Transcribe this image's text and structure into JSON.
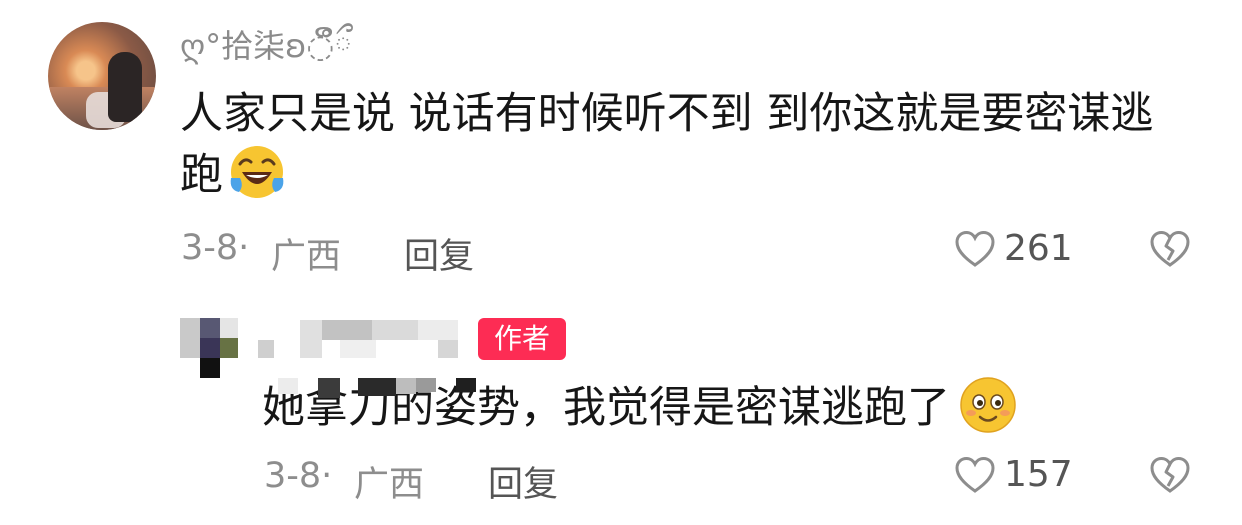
{
  "comments": [
    {
      "username": "ღ°拾柒ʚ◌̊ິྀ",
      "text": "人家只是说 说话有时候听不到 到你这就是要密谋逃跑",
      "emoji": "laughing-crying-emoji",
      "date": "3-8·",
      "location": "广西",
      "reply_label": "回复",
      "likes": "261"
    },
    {
      "author_badge": "作者",
      "text": "她拿刀的姿势，我觉得是密谋逃跑了",
      "emoji": "smile-emoji",
      "date": "3-8·",
      "location": "广西",
      "reply_label": "回复",
      "likes": "157"
    }
  ],
  "colors": {
    "badge": "#fd2c54",
    "meta": "#8d8d8d",
    "text": "#161616"
  }
}
